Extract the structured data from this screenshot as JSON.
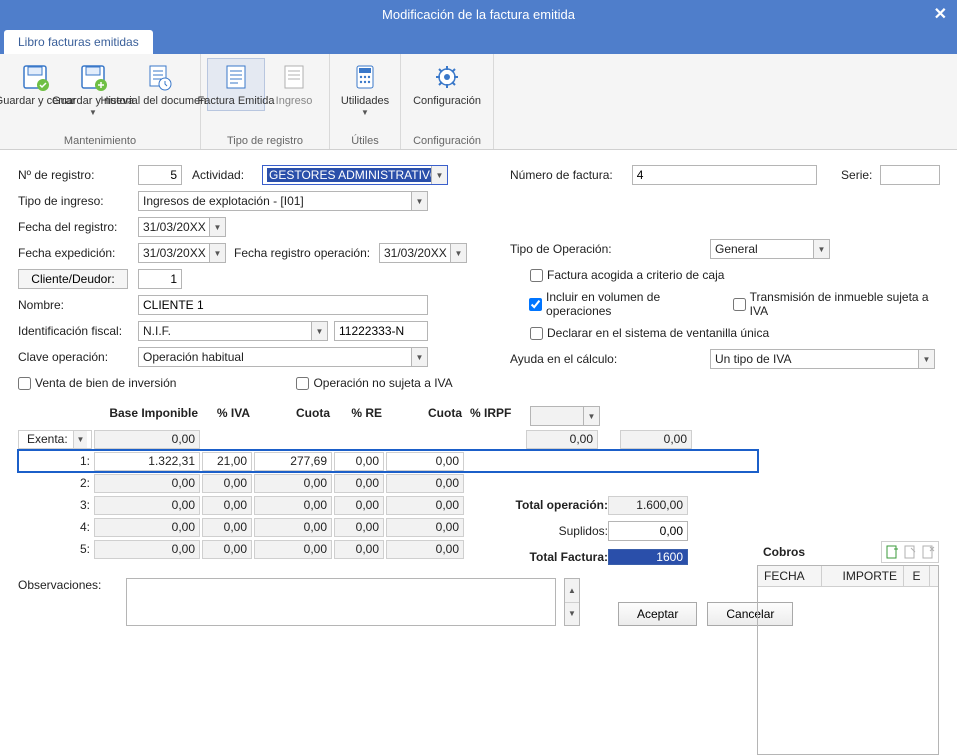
{
  "window": {
    "title": "Modificación de la factura emitida"
  },
  "tab": {
    "label": "Libro facturas emitidas"
  },
  "ribbon": {
    "save_close": "Guardar y cerrar",
    "save_new": "Guardar y nueva",
    "history": "Historial del documento",
    "factura": "Factura Emitida",
    "ingreso": "Ingreso",
    "utilidades": "Utilidades",
    "config": "Configuración",
    "group_maint": "Mantenimiento",
    "group_tipo": "Tipo de registro",
    "group_utiles": "Útiles",
    "group_config": "Configuración"
  },
  "labels": {
    "n_registro": "Nº de registro:",
    "actividad": "Actividad:",
    "numero_factura": "Número de factura:",
    "serie": "Serie:",
    "tipo_ingreso": "Tipo de ingreso:",
    "fecha_registro": "Fecha del registro:",
    "fecha_exped": "Fecha expedición:",
    "fecha_reg_op": "Fecha registro operación:",
    "cliente_deudor": "Cliente/Deudor:",
    "nombre": "Nombre:",
    "ident_fiscal": "Identificación fiscal:",
    "clave_op": "Clave operación:",
    "venta_bien": "Venta de bien de inversión",
    "op_no_iva": "Operación no sujeta a IVA",
    "tipo_operacion": "Tipo de Operación:",
    "factura_caja": "Factura acogida a criterio de caja",
    "incluir_vol": "Incluir en  volumen de operaciones",
    "transm_inmueble": "Transmisión de inmueble sujeta a IVA",
    "declarar_ventanilla": "Declarar en el sistema de ventanilla única",
    "ayuda_calc": "Ayuda en el cálculo:",
    "observ": "Observaciones:",
    "aceptar": "Aceptar",
    "cancelar": "Cancelar"
  },
  "values": {
    "n_registro": "5",
    "actividad": "GESTORES ADMINISTRATIVOS",
    "numero_factura": "4",
    "serie": "",
    "tipo_ingreso": "Ingresos de explotación - [I01]",
    "fecha_registro": "31/03/20XX",
    "fecha_exped": "31/03/20XX",
    "fecha_reg_op": "31/03/20XX",
    "cliente_id": "1",
    "nombre": "CLIENTE 1",
    "ident_tipo": "N.I.F.",
    "ident_num": "11222333-N",
    "clave_op": "Operación habitual",
    "tipo_operacion": "General",
    "ayuda_calc": "Un tipo de IVA",
    "observ": ""
  },
  "iva": {
    "headers": {
      "base": "Base Imponible",
      "pct_iva": "% IVA",
      "cuota": "Cuota",
      "pct_re": "% RE",
      "cuota2": "Cuota",
      "pct_irpf": "% IRPF"
    },
    "exenta_label": "Exenta:",
    "exenta_value": "0,00",
    "irpf_cuota": "0,00",
    "irpf_ret": "0,00",
    "rows": [
      {
        "n": "1:",
        "base": "1.322,31",
        "pct": "21,00",
        "cuota": "277,69",
        "re": "0,00",
        "cuota2": "0,00"
      },
      {
        "n": "2:",
        "base": "0,00",
        "pct": "0,00",
        "cuota": "0,00",
        "re": "0,00",
        "cuota2": "0,00"
      },
      {
        "n": "3:",
        "base": "0,00",
        "pct": "0,00",
        "cuota": "0,00",
        "re": "0,00",
        "cuota2": "0,00"
      },
      {
        "n": "4:",
        "base": "0,00",
        "pct": "0,00",
        "cuota": "0,00",
        "re": "0,00",
        "cuota2": "0,00"
      },
      {
        "n": "5:",
        "base": "0,00",
        "pct": "0,00",
        "cuota": "0,00",
        "re": "0,00",
        "cuota2": "0,00"
      }
    ]
  },
  "totals": {
    "total_op_label": "Total operación:",
    "total_op": "1.600,00",
    "suplidos_label": "Suplidos:",
    "suplidos": "0,00",
    "total_fact_label": "Total Factura:",
    "total_fact": "1600"
  },
  "cobros": {
    "title": "Cobros",
    "col_fecha": "FECHA",
    "col_importe": "IMPORTE",
    "col_e": "E"
  }
}
